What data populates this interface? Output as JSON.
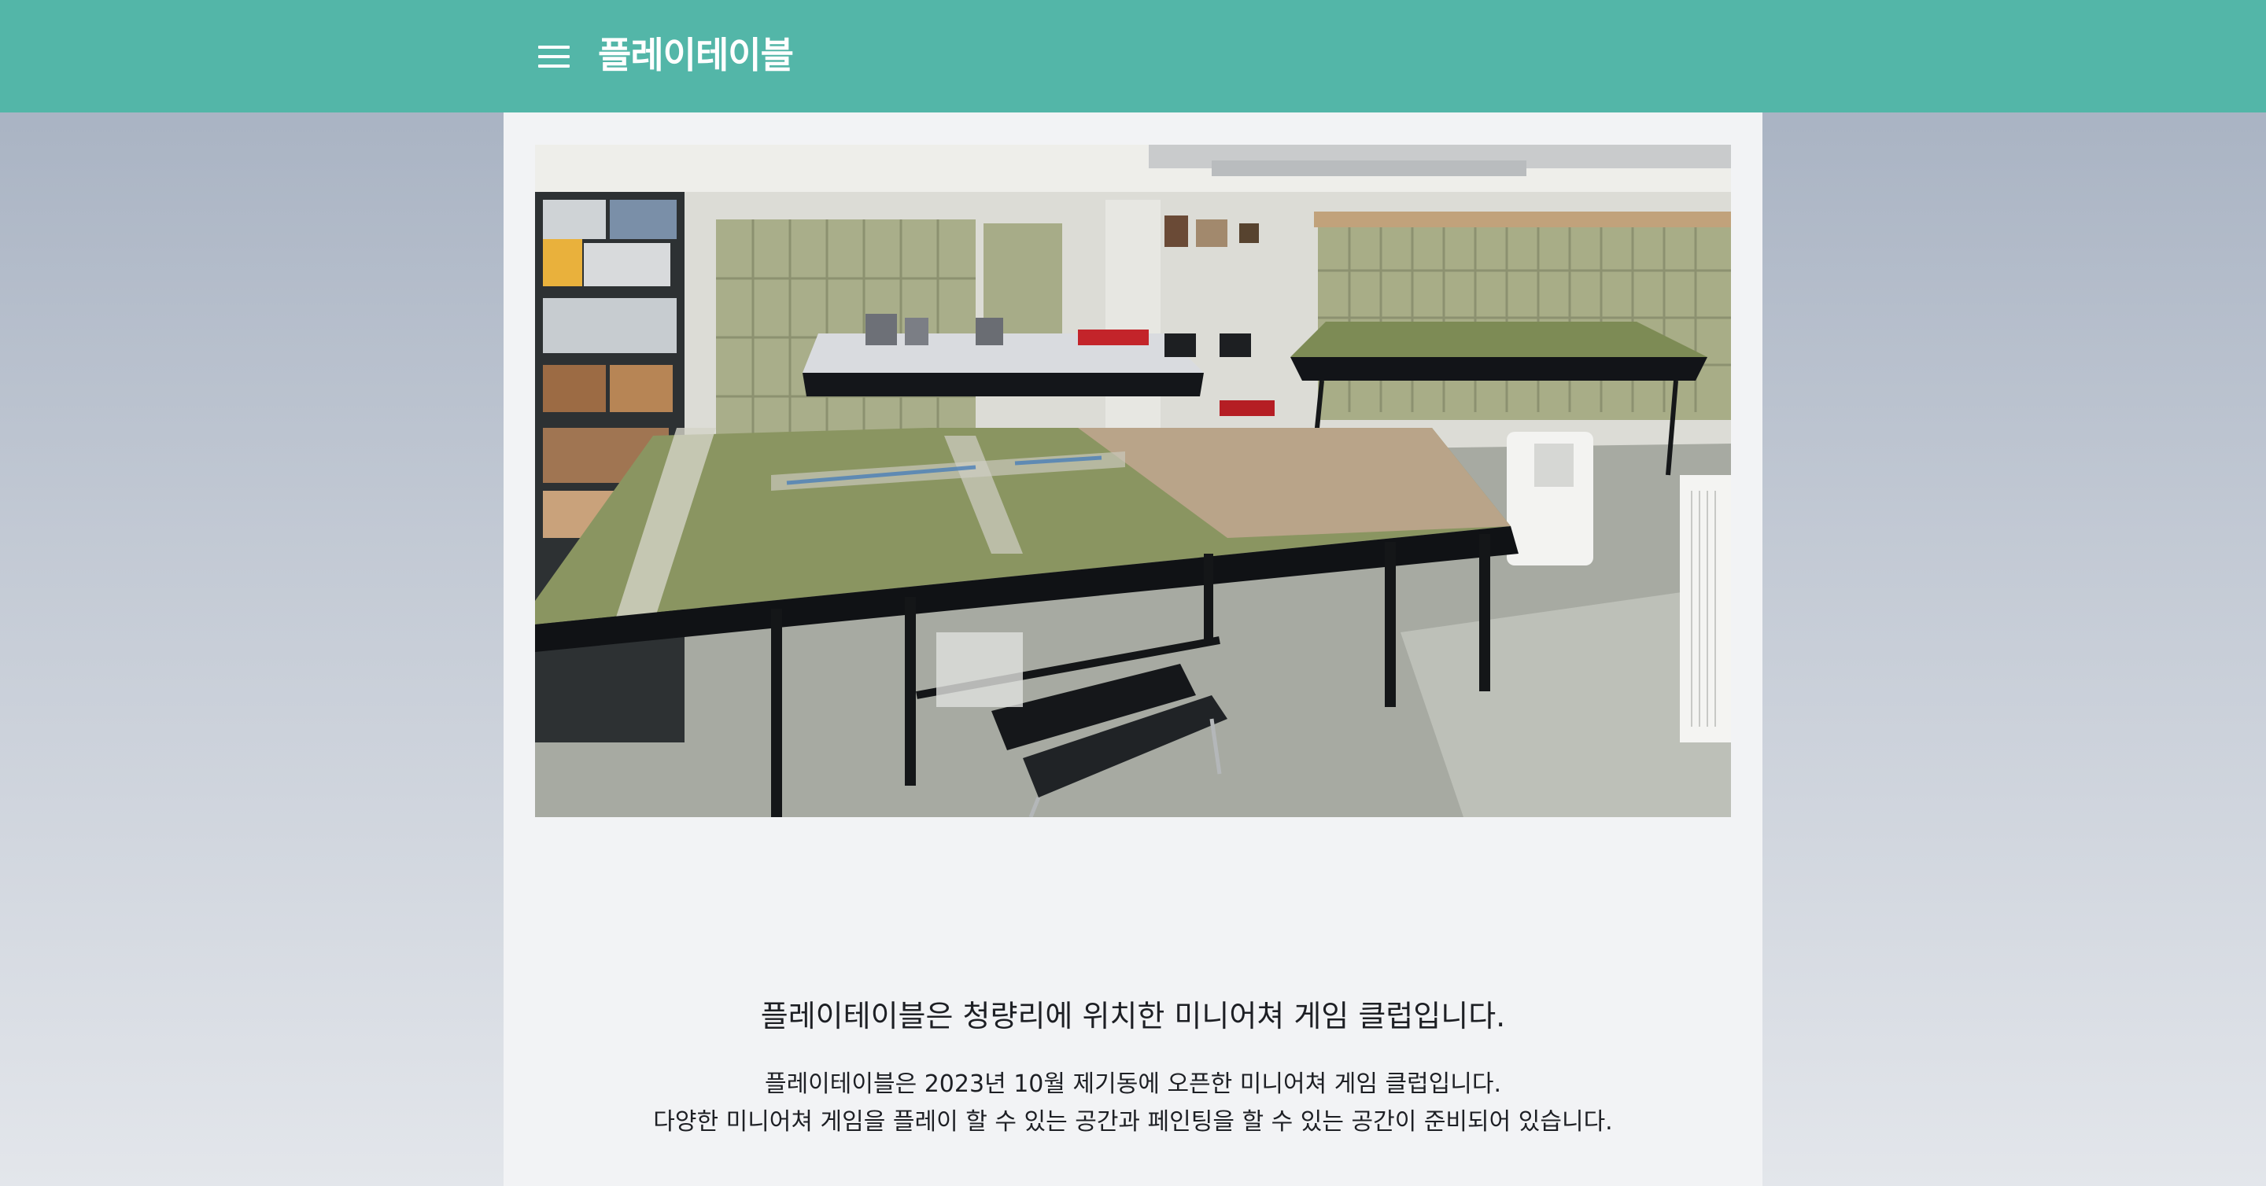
{
  "header": {
    "menu_icon": "hamburger-menu-icon",
    "title": "플레이테이블",
    "background_color": "#53b6a8"
  },
  "main": {
    "photo_alt": "",
    "headline": "플레이테이블은 청량리에 위치한 미니어쳐 게임 클럽입니다.",
    "description": [
      "플레이테이블은 2023년 10월 제기동에 오픈한 미니어쳐 게임 클럽입니다.",
      "다양한 미니어쳐 게임을 플레이 할 수 있는 공간과 페인팅을 할 수 있는 공간이 준비되어 있습니다."
    ]
  }
}
